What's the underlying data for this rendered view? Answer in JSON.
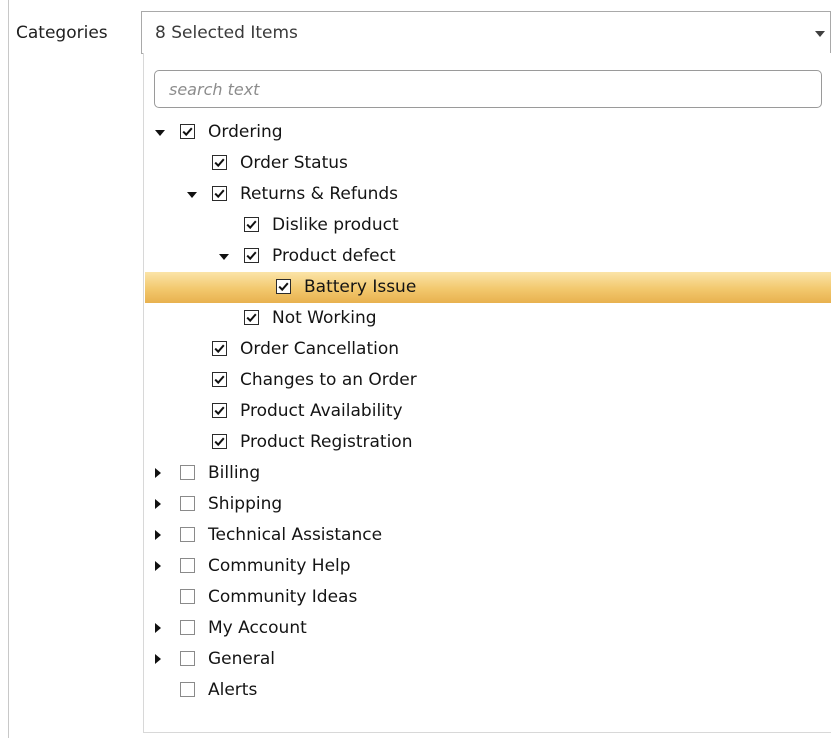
{
  "field": {
    "label": "Categories"
  },
  "combo": {
    "value": "8 Selected Items"
  },
  "search": {
    "placeholder": "search text"
  },
  "tree": [
    {
      "label": "Ordering",
      "level": 0,
      "expander": "expanded",
      "checked": true,
      "selected": false
    },
    {
      "label": "Order Status",
      "level": 1,
      "expander": "none",
      "checked": true,
      "selected": false
    },
    {
      "label": "Returns & Refunds",
      "level": 1,
      "expander": "expanded",
      "checked": true,
      "selected": false
    },
    {
      "label": "Dislike product",
      "level": 2,
      "expander": "none",
      "checked": true,
      "selected": false
    },
    {
      "label": "Product defect",
      "level": 2,
      "expander": "expanded",
      "checked": true,
      "selected": false
    },
    {
      "label": "Battery Issue",
      "level": 3,
      "expander": "none",
      "checked": true,
      "selected": true
    },
    {
      "label": "Not Working",
      "level": 2,
      "expander": "none",
      "checked": true,
      "selected": false
    },
    {
      "label": "Order Cancellation",
      "level": 1,
      "expander": "none",
      "checked": true,
      "selected": false
    },
    {
      "label": "Changes to an Order",
      "level": 1,
      "expander": "none",
      "checked": true,
      "selected": false
    },
    {
      "label": "Product Availability",
      "level": 1,
      "expander": "none",
      "checked": true,
      "selected": false
    },
    {
      "label": "Product Registration",
      "level": 1,
      "expander": "none",
      "checked": true,
      "selected": false
    },
    {
      "label": "Billing",
      "level": 0,
      "expander": "collapsed",
      "checked": false,
      "selected": false
    },
    {
      "label": "Shipping",
      "level": 0,
      "expander": "collapsed",
      "checked": false,
      "selected": false
    },
    {
      "label": "Technical Assistance",
      "level": 0,
      "expander": "collapsed",
      "checked": false,
      "selected": false
    },
    {
      "label": "Community Help",
      "level": 0,
      "expander": "collapsed",
      "checked": false,
      "selected": false
    },
    {
      "label": "Community Ideas",
      "level": 0,
      "expander": "none",
      "checked": false,
      "selected": false
    },
    {
      "label": "My Account",
      "level": 0,
      "expander": "collapsed",
      "checked": false,
      "selected": false
    },
    {
      "label": "General",
      "level": 0,
      "expander": "collapsed",
      "checked": false,
      "selected": false
    },
    {
      "label": "Alerts",
      "level": 0,
      "expander": "none",
      "checked": false,
      "selected": false
    }
  ]
}
